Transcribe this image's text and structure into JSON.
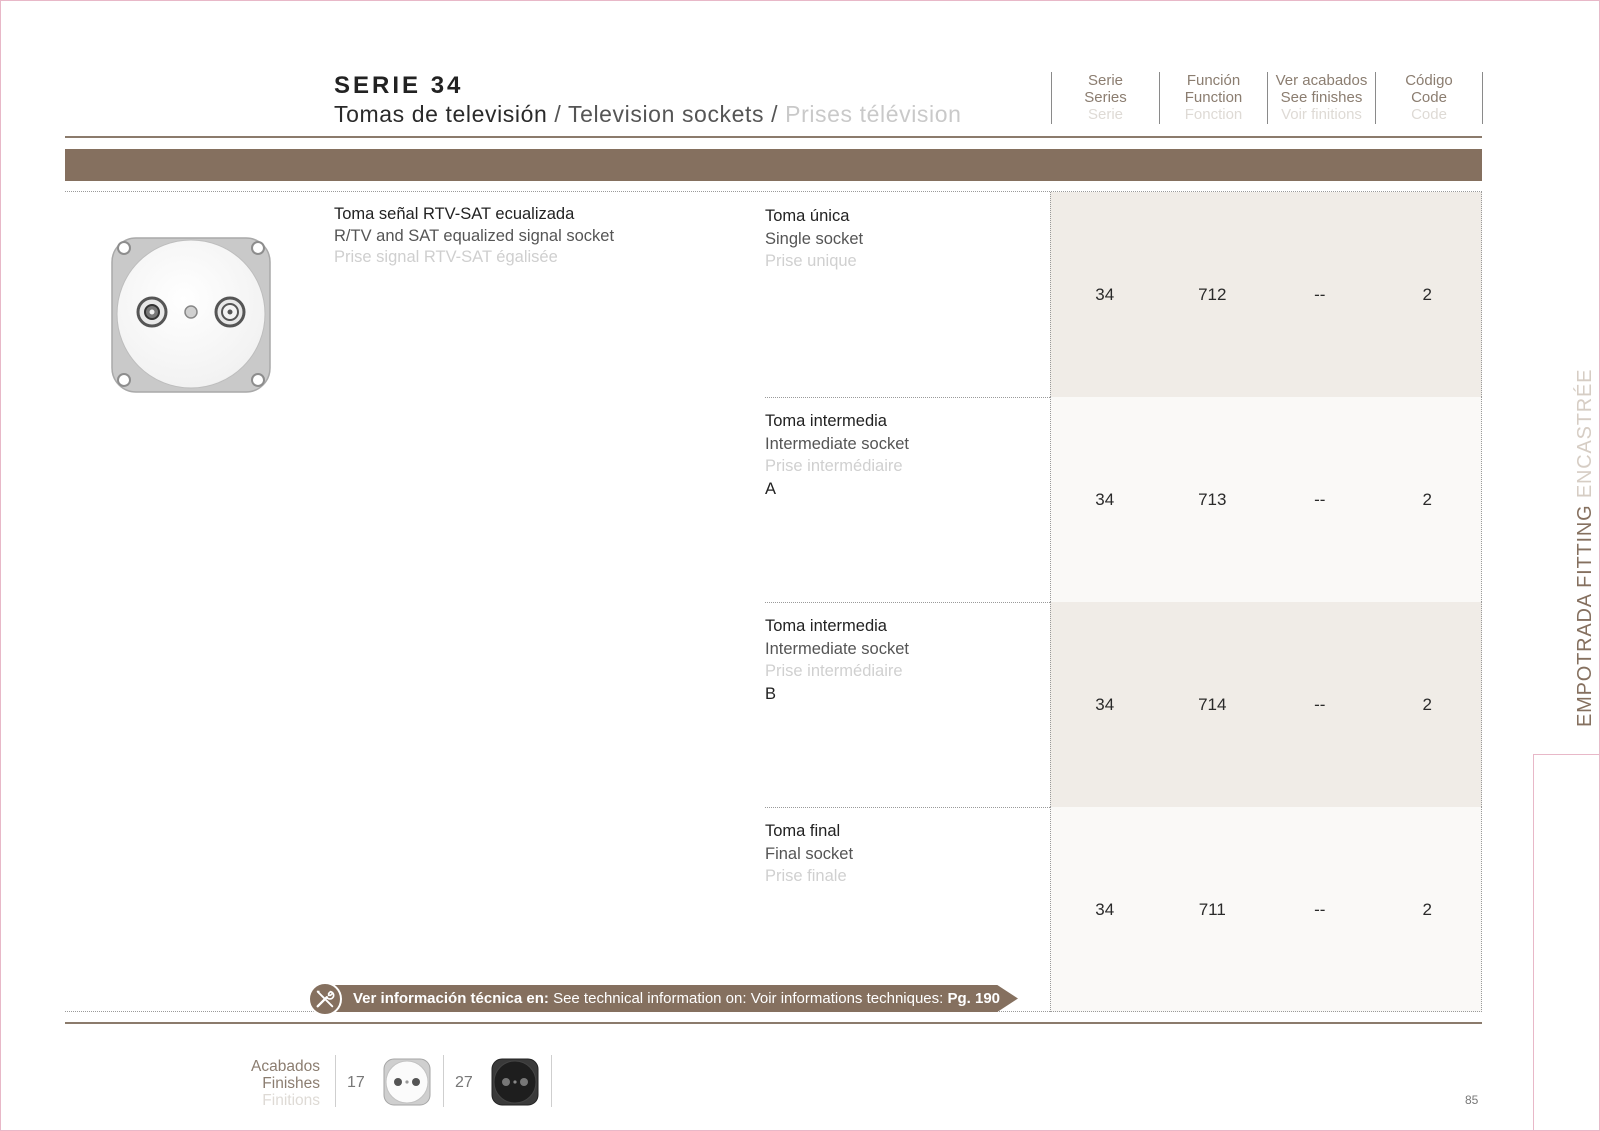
{
  "header": {
    "title": "SERIE 34",
    "subtitle_es": "Tomas de televisión",
    "subtitle_sep": " / ",
    "subtitle_en": "Television sockets",
    "subtitle_fr": "Prises télévision"
  },
  "columns": [
    {
      "es": "Serie",
      "en": "Series",
      "fr": "Serie"
    },
    {
      "es": "Función",
      "en": "Function",
      "fr": "Fonction"
    },
    {
      "es": "Ver acabados",
      "en": "See finishes",
      "fr": "Voir finitions"
    },
    {
      "es": "Código",
      "en": "Code",
      "fr": "Code"
    }
  ],
  "product": {
    "image_icon": "tv-sat-socket-white",
    "desc_es": "Toma señal RTV-SAT ecualizada",
    "desc_en": "R/TV and SAT equalized signal socket",
    "desc_fr": "Prise signal RTV-SAT égalisée"
  },
  "rows": [
    {
      "es": "Toma única",
      "en": "Single socket",
      "fr": "Prise unique",
      "variant": "",
      "serie": "34",
      "function": "712",
      "finishes": "--",
      "code": "2"
    },
    {
      "es": "Toma intermedia",
      "en": "Intermediate socket",
      "fr": "Prise intermédiaire",
      "variant": "A",
      "serie": "34",
      "function": "713",
      "finishes": "--",
      "code": "2"
    },
    {
      "es": "Toma intermedia",
      "en": "Intermediate socket",
      "fr": "Prise intermédiaire",
      "variant": "B",
      "serie": "34",
      "function": "714",
      "finishes": "--",
      "code": "2"
    },
    {
      "es": "Toma final",
      "en": "Final socket",
      "fr": "Prise finale",
      "variant": "",
      "serie": "34",
      "function": "711",
      "finishes": "--",
      "code": "2"
    }
  ],
  "tech_info": {
    "icon": "tools-icon",
    "es": "Ver información técnica en:",
    "en": "See technical information on:",
    "fr": "Voir informations techniques:",
    "page": "Pg. 190"
  },
  "finishes": {
    "label_es": "Acabados",
    "label_en": "Finishes",
    "label_fr": "Finitions",
    "items": [
      {
        "code": "17",
        "icon": "white-finish-socket"
      },
      {
        "code": "27",
        "icon": "black-finish-socket"
      }
    ]
  },
  "side_tab": {
    "part1": "EMPOTRADA FITTING",
    "part2": " ENCASTRÉE"
  },
  "page_number": "85",
  "colors": {
    "accent": "#85705f",
    "shade": "#f0ece7",
    "light_shade": "#faf9f7"
  }
}
